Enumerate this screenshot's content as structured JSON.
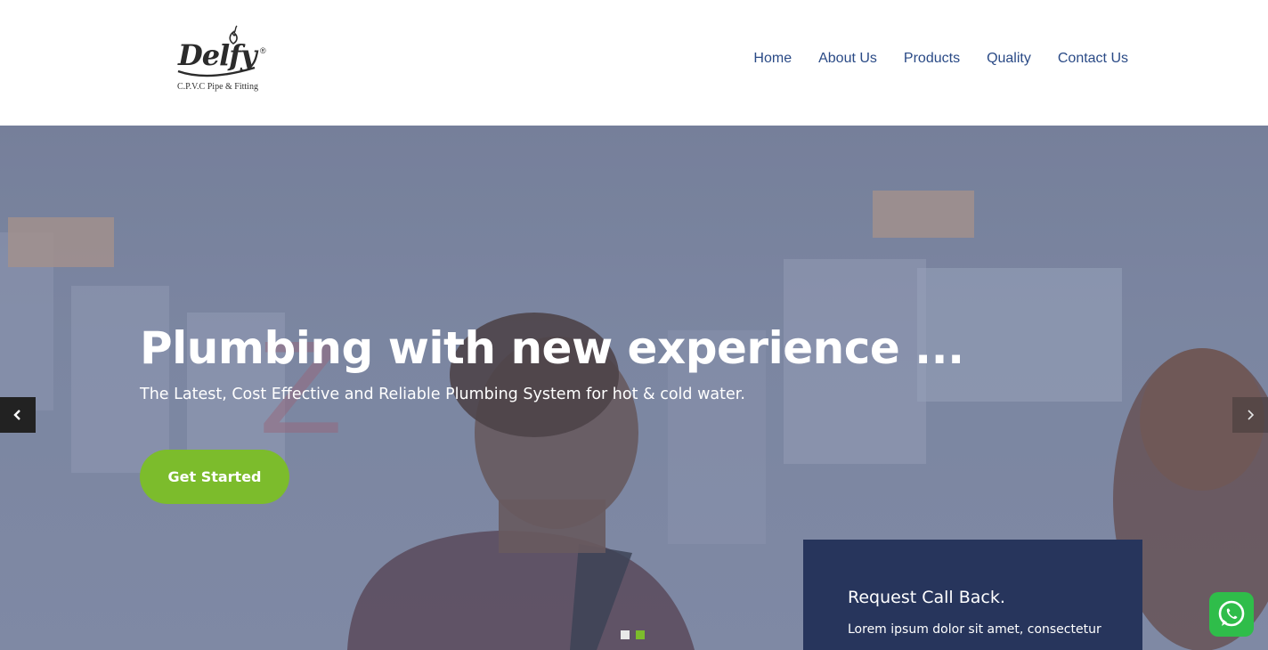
{
  "brand": {
    "name": "Delfy",
    "registered": "®",
    "tagline": "C.P.V.C Pipe & Fitting"
  },
  "nav": {
    "items": [
      {
        "label": "Home"
      },
      {
        "label": "About Us"
      },
      {
        "label": "Products"
      },
      {
        "label": "Quality"
      },
      {
        "label": "Contact Us"
      }
    ]
  },
  "hero": {
    "title": "Plumbing with new experience ...",
    "subtitle": "The Latest, Cost Effective and Reliable Plumbing System for hot & cold water.",
    "cta_label": "Get Started",
    "slides": {
      "count": 2,
      "active": 2
    }
  },
  "callback": {
    "title": "Request Call Back.",
    "text": "Lorem ipsum dolor sit amet, consectetur"
  },
  "icons": {
    "prev": "chevron-left-icon",
    "next": "chevron-right-icon",
    "whatsapp": "whatsapp-icon"
  },
  "colors": {
    "nav_link": "#2a4a86",
    "accent_green": "#7cbc2c",
    "panel_navy": "#27355c",
    "whatsapp_green": "#2fbd4a"
  }
}
